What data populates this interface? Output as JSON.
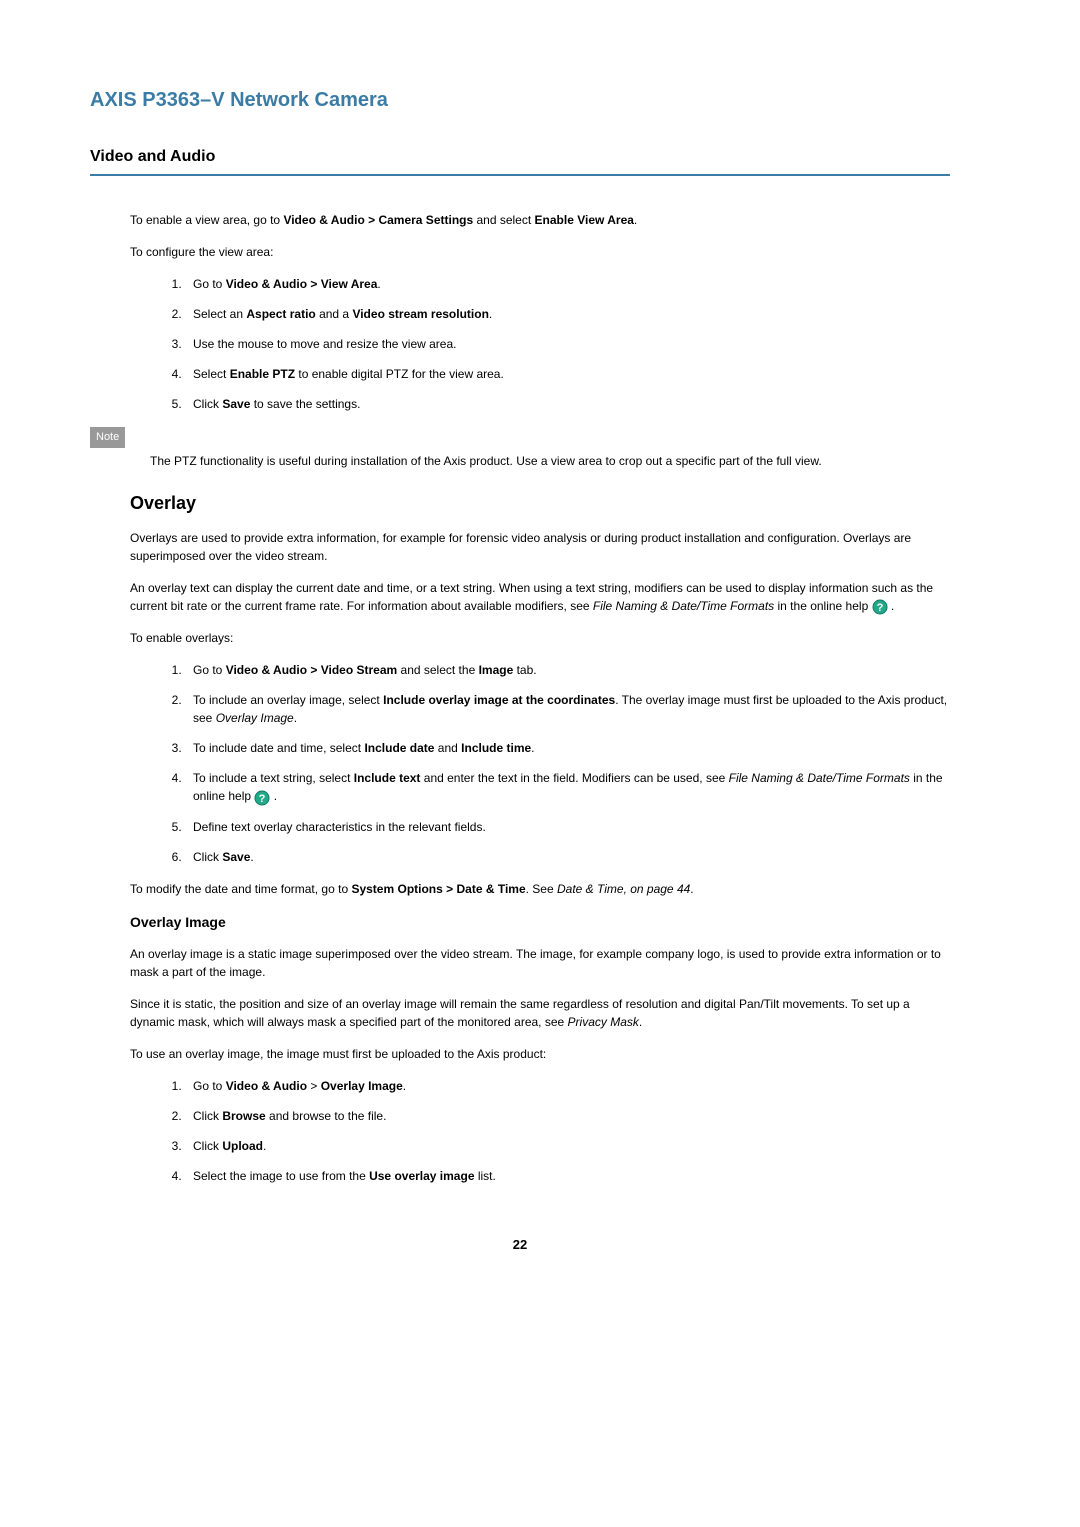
{
  "header": {
    "product_title": "AXIS P3363–V Network Camera",
    "section_title": "Video and Audio"
  },
  "intro": {
    "enable_prefix": "To enable a view area, go to ",
    "enable_path": "Video & Audio > Camera Settings",
    "enable_mid": " and select ",
    "enable_action": "Enable View Area",
    "enable_suffix": ".",
    "configure_text": "To configure the view area:"
  },
  "configure_list": {
    "item1_prefix": "Go to ",
    "item1_bold": "Video & Audio > View Area",
    "item1_suffix": ".",
    "item2_prefix": "Select an ",
    "item2_bold1": "Aspect ratio",
    "item2_mid": " and a ",
    "item2_bold2": "Video stream resolution",
    "item2_suffix": ".",
    "item3": "Use the mouse to move and resize the view area.",
    "item4_prefix": "Select ",
    "item4_bold": "Enable PTZ",
    "item4_suffix": " to enable digital PTZ for the view area.",
    "item5_prefix": "Click ",
    "item5_bold": "Save",
    "item5_suffix": " to save the settings."
  },
  "note": {
    "label": "Note",
    "text": "The PTZ functionality is useful during installation of the Axis product. Use a view area to crop out a specific part of the full view."
  },
  "overlay": {
    "title": "Overlay",
    "para1": "Overlays are used to provide extra information, for example for forensic video analysis or during product installation and configuration. Overlays are superimposed over the video stream.",
    "para2_part1": "An overlay text can display the current date and time, or a text string. When using a text string, modifiers can be used to display information such as the current bit rate or the current frame rate. For information about available modifiers, see ",
    "para2_italic": "File Naming & Date/Time Formats",
    "para2_part2": " in the online help ",
    "para2_suffix": " .",
    "enable_text": "To enable overlays:"
  },
  "overlay_list": {
    "item1_prefix": "Go to ",
    "item1_bold": "Video & Audio > Video Stream",
    "item1_mid": " and select the ",
    "item1_bold2": "Image",
    "item1_suffix": " tab.",
    "item2_prefix": "To include an overlay image, select ",
    "item2_bold": "Include overlay image at the coordinates",
    "item2_mid": ". The overlay image must first be uploaded to the Axis product, see ",
    "item2_italic": "Overlay Image",
    "item2_suffix": ".",
    "item3_prefix": "To include date and time, select ",
    "item3_bold1": "Include date",
    "item3_mid": " and ",
    "item3_bold2": "Include time",
    "item3_suffix": ".",
    "item4_prefix": "To include a text string, select ",
    "item4_bold": "Include text",
    "item4_mid": " and enter the text in the field. Modifiers can be used, see ",
    "item4_italic": "File Naming & Date/Time Formats",
    "item4_mid2": " in the online help ",
    "item4_suffix": " .",
    "item5": "Define text overlay characteristics in the relevant fields.",
    "item6_prefix": "Click ",
    "item6_bold": "Save",
    "item6_suffix": "."
  },
  "modify_para": {
    "prefix": "To modify the date and time format, go to ",
    "bold": "System Options > Date & Time",
    "mid": ". See ",
    "italic": "Date & Time, on page 44",
    "suffix": "."
  },
  "overlay_image": {
    "title": "Overlay Image",
    "para1": "An overlay image is a static image superimposed over the video stream. The image, for example company logo, is used to provide extra information or to mask a part of the image.",
    "para2_part1": "Since it is static, the position and size of an overlay image will remain the same regardless of resolution and digital Pan/Tilt movements. To set up a dynamic mask, which will always mask a specified part of the monitored area, see ",
    "para2_italic": "Privacy Mask",
    "para2_suffix": ".",
    "para3": "To use an overlay image, the image must first be uploaded to the Axis product:"
  },
  "overlay_image_list": {
    "item1_prefix": "Go to ",
    "item1_bold": "Video & Audio",
    "item1_mid": " > ",
    "item1_bold2": "Overlay Image",
    "item1_suffix": ".",
    "item2_prefix": "Click ",
    "item2_bold": "Browse",
    "item2_suffix": " and browse to the file.",
    "item3_prefix": "Click ",
    "item3_bold": "Upload",
    "item3_suffix": ".",
    "item4_prefix": "Select the image to use from the ",
    "item4_bold": "Use overlay image",
    "item4_suffix": " list."
  },
  "page_number": "22"
}
